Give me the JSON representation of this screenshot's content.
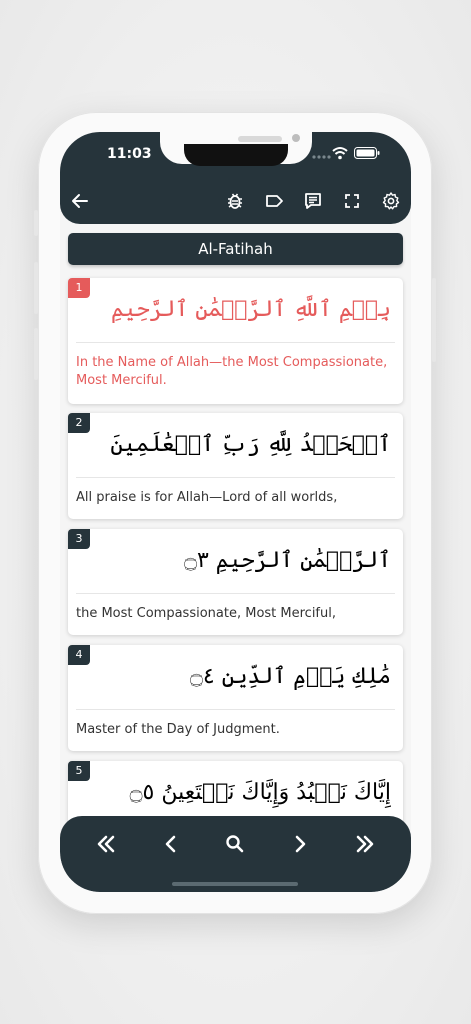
{
  "status": {
    "time": "11:03"
  },
  "toolbar": {
    "icons": [
      "back-arrow-icon",
      "bug-icon",
      "tag-icon",
      "notes-icon",
      "fullscreen-icon",
      "settings-icon"
    ]
  },
  "surah": {
    "title": "Al-Fatihah"
  },
  "verses": [
    {
      "number": "1",
      "arabic": "بِسۡمِ ٱللَّهِ ٱلرَّحۡمَٰنِ ٱلرَّحِيمِ ۝١",
      "translation": "In the Name of Allah—the Most Compassionate, Most Merciful.",
      "highlighted": true
    },
    {
      "number": "2",
      "arabic": "ٱلۡحَمۡدُ لِلَّهِ رَبِّ ٱلۡعَٰلَمِينَ ۝٢",
      "translation": "All praise is for Allah—Lord of all worlds,",
      "highlighted": false
    },
    {
      "number": "3",
      "arabic": "ٱلرَّحۡمَٰنِ ٱلرَّحِيمِ ۝٣",
      "translation": "the Most Compassionate, Most Merciful,",
      "highlighted": false
    },
    {
      "number": "4",
      "arabic": "مَٰلِكِ يَوۡمِ ٱلدِّينِ ۝٤",
      "translation": "Master of the Day of Judgment.",
      "highlighted": false
    },
    {
      "number": "5",
      "arabic": "إِيَّاكَ نَعۡبُدُ وَإِيَّاكَ نَسۡتَعِينُ ۝٥",
      "translation": "",
      "highlighted": false
    }
  ],
  "colors": {
    "primary": "#26343b",
    "accent": "#e55b5b",
    "background": "#f5f5f5"
  },
  "bottom_nav": {
    "icons": [
      "first-icon",
      "previous-icon",
      "search-icon",
      "next-icon",
      "last-icon"
    ]
  }
}
